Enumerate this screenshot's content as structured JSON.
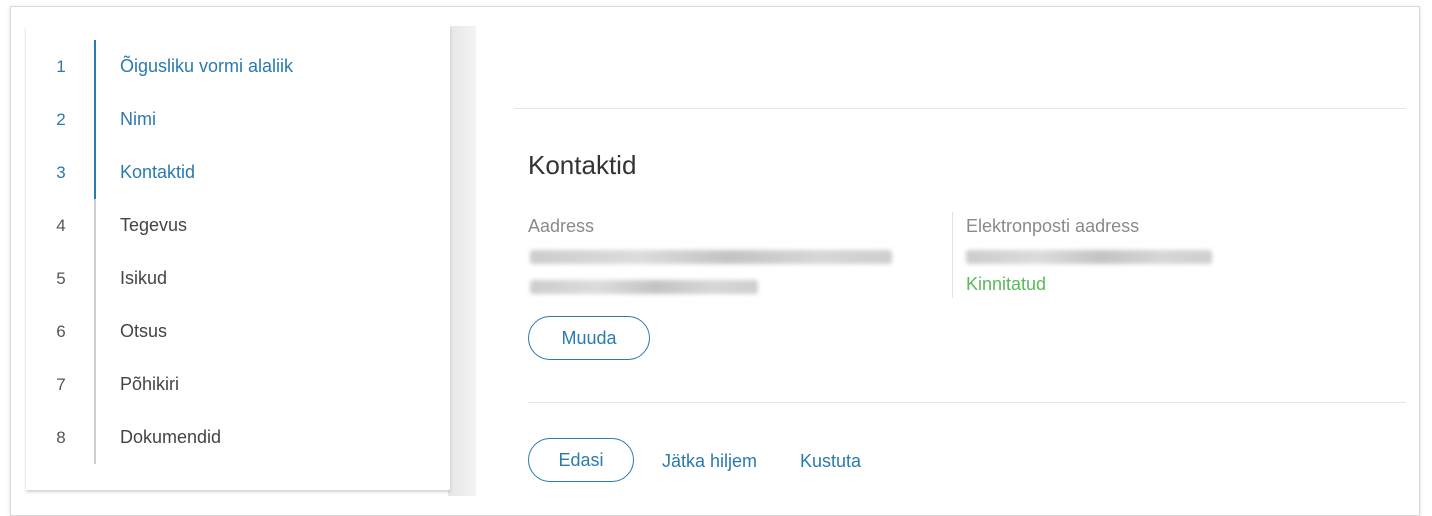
{
  "steps": [
    {
      "num": "1",
      "label": "Õigusliku vormi alaliik",
      "state": "done"
    },
    {
      "num": "2",
      "label": "Nimi",
      "state": "done"
    },
    {
      "num": "3",
      "label": "Kontaktid",
      "state": "current"
    },
    {
      "num": "4",
      "label": "Tegevus",
      "state": "todo"
    },
    {
      "num": "5",
      "label": "Isikud",
      "state": "todo"
    },
    {
      "num": "6",
      "label": "Otsus",
      "state": "todo"
    },
    {
      "num": "7",
      "label": "Põhikiri",
      "state": "todo"
    },
    {
      "num": "8",
      "label": "Dokumendid",
      "state": "todo"
    }
  ],
  "section": {
    "title": "Kontaktid",
    "address_label": "Aadress",
    "email_label": "Elektronposti aadress",
    "email_status": "Kinnitatud",
    "edit_button": "Muuda"
  },
  "actions": {
    "next_button": "Edasi",
    "later_link": "Jätka hiljem",
    "delete_link": "Kustuta"
  },
  "colors": {
    "accent": "#2a7ab0",
    "success": "#5cb85c",
    "muted_text": "#8a8a8a"
  }
}
